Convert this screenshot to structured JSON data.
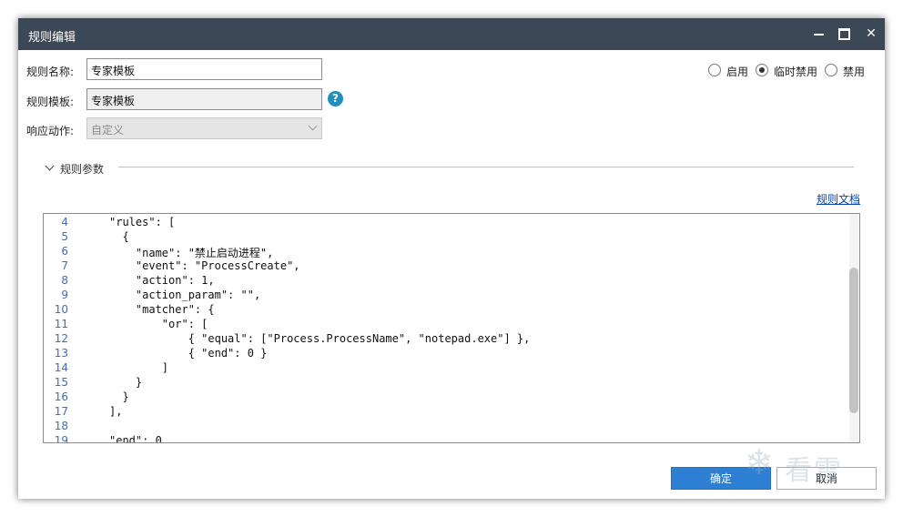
{
  "window": {
    "title": "规则编辑"
  },
  "form": {
    "name_label": "规则名称:",
    "name_value": "专家模板",
    "template_label": "规则模板:",
    "template_value": "专家模板",
    "help_glyph": "?",
    "action_label": "响应动作:",
    "action_value": "自定义"
  },
  "status": {
    "selected": "临时禁用",
    "options": [
      "启用",
      "临时禁用",
      "禁用"
    ]
  },
  "section": {
    "title": "规则参数",
    "doc_link": "规则文档"
  },
  "editor": {
    "lines": [
      {
        "n": "4",
        "code": "\"rules\": ["
      },
      {
        "n": "5",
        "code": "  {"
      },
      {
        "n": "6",
        "code": "    \"name\": \"禁止启动进程\","
      },
      {
        "n": "7",
        "code": "    \"event\": \"ProcessCreate\","
      },
      {
        "n": "8",
        "code": "    \"action\": 1,"
      },
      {
        "n": "9",
        "code": "    \"action_param\": \"\","
      },
      {
        "n": "10",
        "code": "    \"matcher\": {"
      },
      {
        "n": "11",
        "code": "        \"or\": ["
      },
      {
        "n": "12",
        "code": "            { \"equal\": [\"Process.ProcessName\", \"notepad.exe\"] },"
      },
      {
        "n": "13",
        "code": "            { \"end\": 0 }"
      },
      {
        "n": "14",
        "code": "        ]"
      },
      {
        "n": "15",
        "code": "    }"
      },
      {
        "n": "16",
        "code": "  }"
      },
      {
        "n": "17",
        "code": "],"
      },
      {
        "n": "18",
        "code": ""
      },
      {
        "n": "19",
        "code": "\"end\": 0"
      }
    ]
  },
  "buttons": {
    "ok": "确定",
    "cancel": "取消"
  },
  "watermark": {
    "text": "看雪"
  }
}
